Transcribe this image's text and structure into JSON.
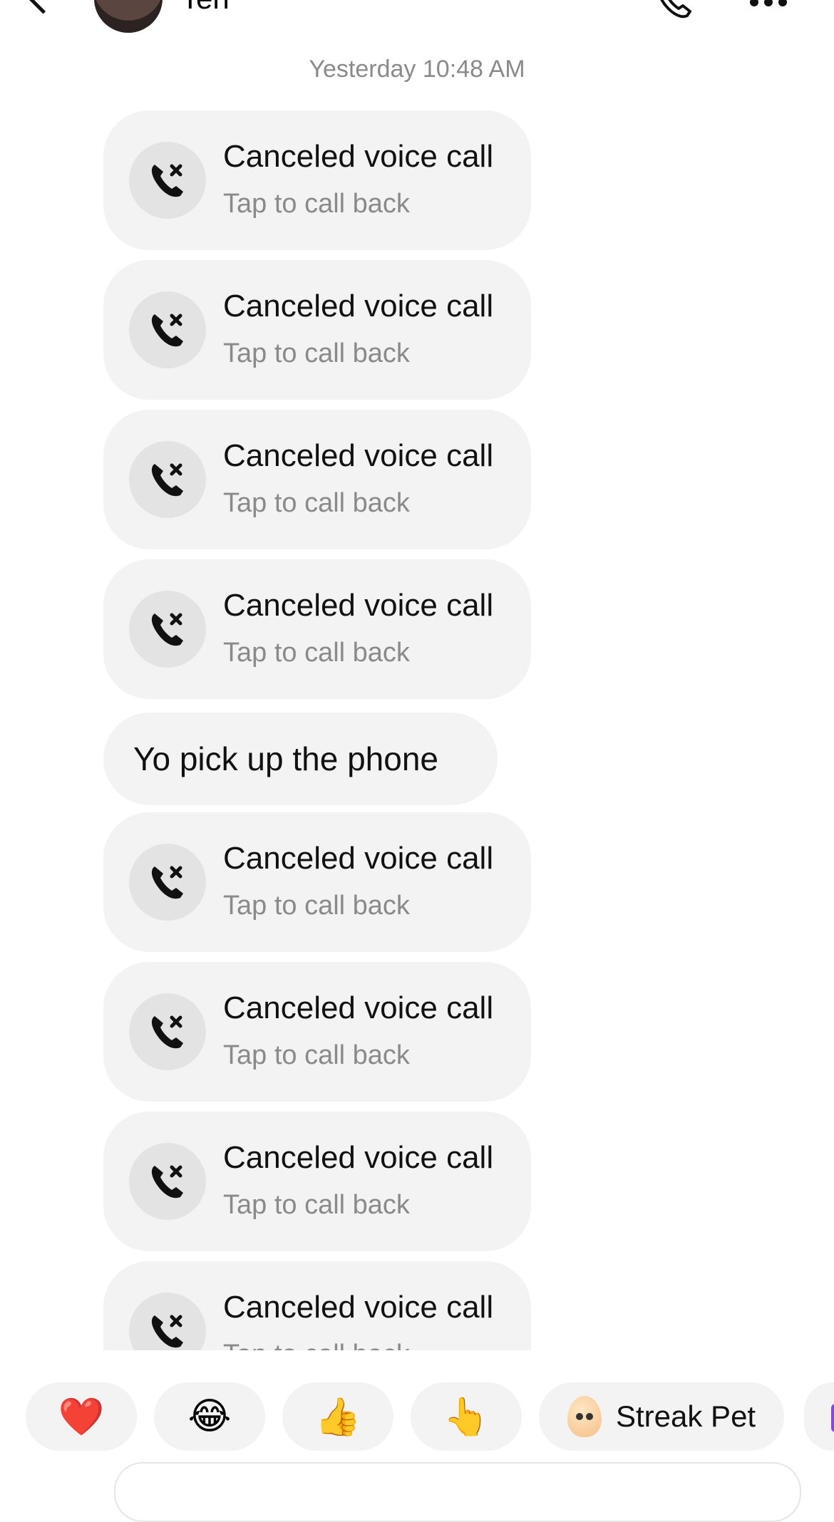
{
  "header": {
    "contact_name": "Ten",
    "icons": [
      "back-chevron-icon",
      "phone-icon",
      "more-icon"
    ]
  },
  "timestamp": "Yesterday 10:48 AM",
  "messages": {
    "calls": [
      {
        "title": "Canceled voice call",
        "subtitle": "Tap to call back",
        "icon": "missed-call-icon"
      },
      {
        "title": "Canceled voice call",
        "subtitle": "Tap to call back",
        "icon": "missed-call-icon"
      },
      {
        "title": "Canceled voice call",
        "subtitle": "Tap to call back",
        "icon": "missed-call-icon"
      },
      {
        "title": "Canceled voice call",
        "subtitle": "Tap to call back",
        "icon": "missed-call-icon"
      },
      {
        "title": "Canceled voice call",
        "subtitle": "Tap to call back",
        "icon": "missed-call-icon"
      },
      {
        "title": "Canceled voice call",
        "subtitle": "Tap to call back",
        "icon": "missed-call-icon"
      },
      {
        "title": "Canceled voice call",
        "subtitle": "Tap to call back",
        "icon": "missed-call-icon"
      },
      {
        "title": "Canceled voice call",
        "subtitle": "Tap to call back",
        "icon": "missed-call-icon"
      }
    ],
    "text": "Yo pick up the phone"
  },
  "reactions": {
    "heart": "❤️",
    "laugh": "😂",
    "thumbs_up": "👍",
    "point": "👆",
    "streak_pet_label": "Streak Pet"
  },
  "colors": {
    "bubble": "#f3f3f3",
    "secondary_text": "#8a8a8a"
  }
}
